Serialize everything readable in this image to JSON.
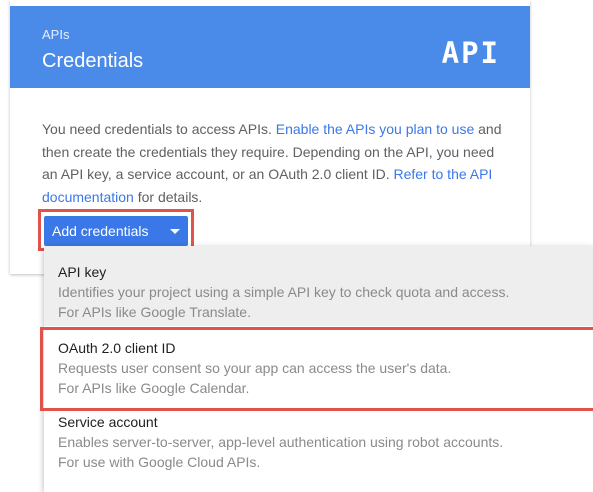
{
  "header": {
    "breadcrumb": "APIs",
    "title": "Credentials",
    "logo_text": "API",
    "background": "#4a8be9"
  },
  "description": {
    "text_1": "You need credentials to access APIs. ",
    "link_1": "Enable the APIs you plan to use",
    "text_2": " and then create the credentials they require. Depending on the API, you need an API key, a service account, or an OAuth 2.0 client ID. ",
    "link_2": "Refer to the API documentation",
    "text_3": " for details."
  },
  "add_button": {
    "label": "Add credentials",
    "icon": "caret-down-icon",
    "color": "#3b78e7"
  },
  "highlight_color": "#e0524b",
  "menu": {
    "items": [
      {
        "name": "API key",
        "line_1": "Identifies your project using a simple API key to check quota and access.",
        "line_2": "For APIs like Google Translate.",
        "hovered": true
      },
      {
        "name": "OAuth 2.0 client ID",
        "line_1": "Requests user consent so your app can access the user's data.",
        "line_2": "For APIs like Google Calendar.",
        "highlighted": true
      },
      {
        "name": "Service account",
        "line_1": "Enables server-to-server, app-level authentication using robot accounts.",
        "line_2": "For use with Google Cloud APIs."
      }
    ]
  }
}
